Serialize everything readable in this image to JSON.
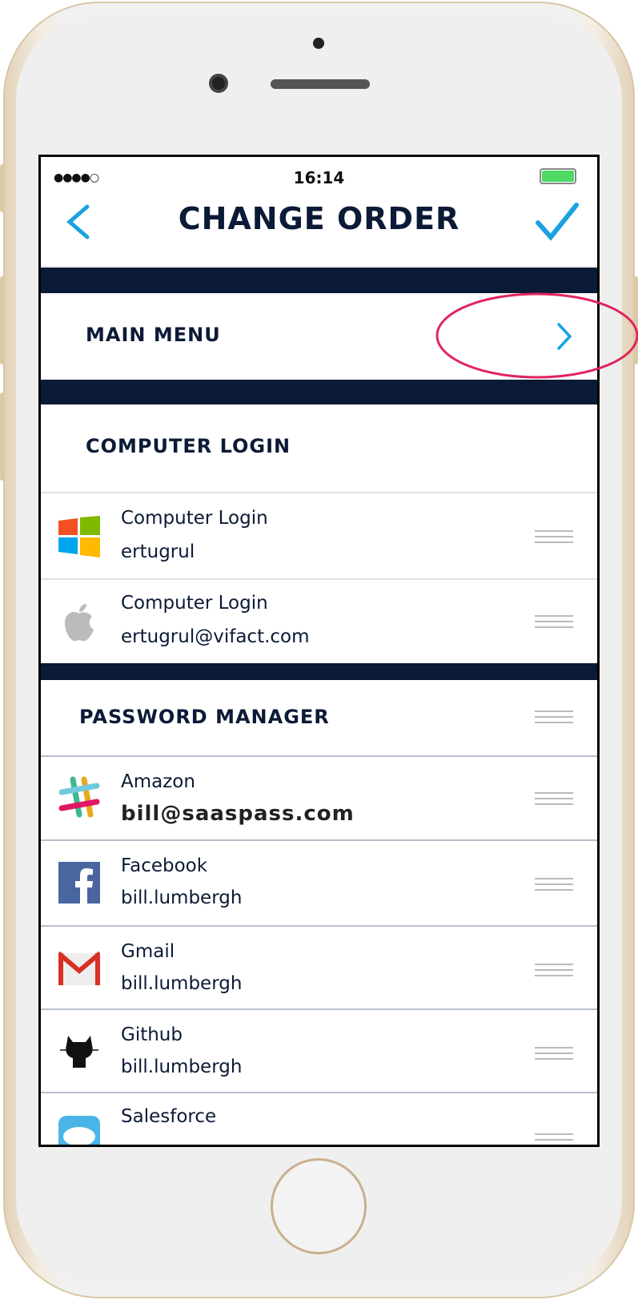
{
  "status_bar": {
    "time": "16:14",
    "signal": "4 of 5",
    "battery_color": "#4cd964"
  },
  "header": {
    "title": "CHANGE ORDER",
    "back_icon": "chevron-left-icon",
    "confirm_icon": "checkmark-icon",
    "accent": "#1aa3e0"
  },
  "main_menu": {
    "label": "MAIN MENU"
  },
  "computer_login": {
    "section": "COMPUTER LOGIN",
    "items": [
      {
        "icon": "windows-icon",
        "title": "Computer Login",
        "subtitle": "ertugrul"
      },
      {
        "icon": "apple-icon",
        "title": "Computer Login",
        "subtitle": "ertugrul@vifact.com"
      }
    ]
  },
  "password_manager": {
    "section": "PASSWORD MANAGER",
    "items": [
      {
        "icon": "slack-icon",
        "title": "Amazon",
        "subtitle": "bill@saaspass.com"
      },
      {
        "icon": "facebook-icon",
        "title": "Facebook",
        "subtitle": "bill.lumbergh"
      },
      {
        "icon": "gmail-icon",
        "title": "Gmail",
        "subtitle": "bill.lumbergh"
      },
      {
        "icon": "github-icon",
        "title": "Github",
        "subtitle": "bill.lumbergh"
      },
      {
        "icon": "salesforce-icon",
        "title": "Salesforce",
        "subtitle": ""
      }
    ]
  },
  "colors": {
    "navy": "#0b1a36",
    "highlight": "#e0245e"
  }
}
